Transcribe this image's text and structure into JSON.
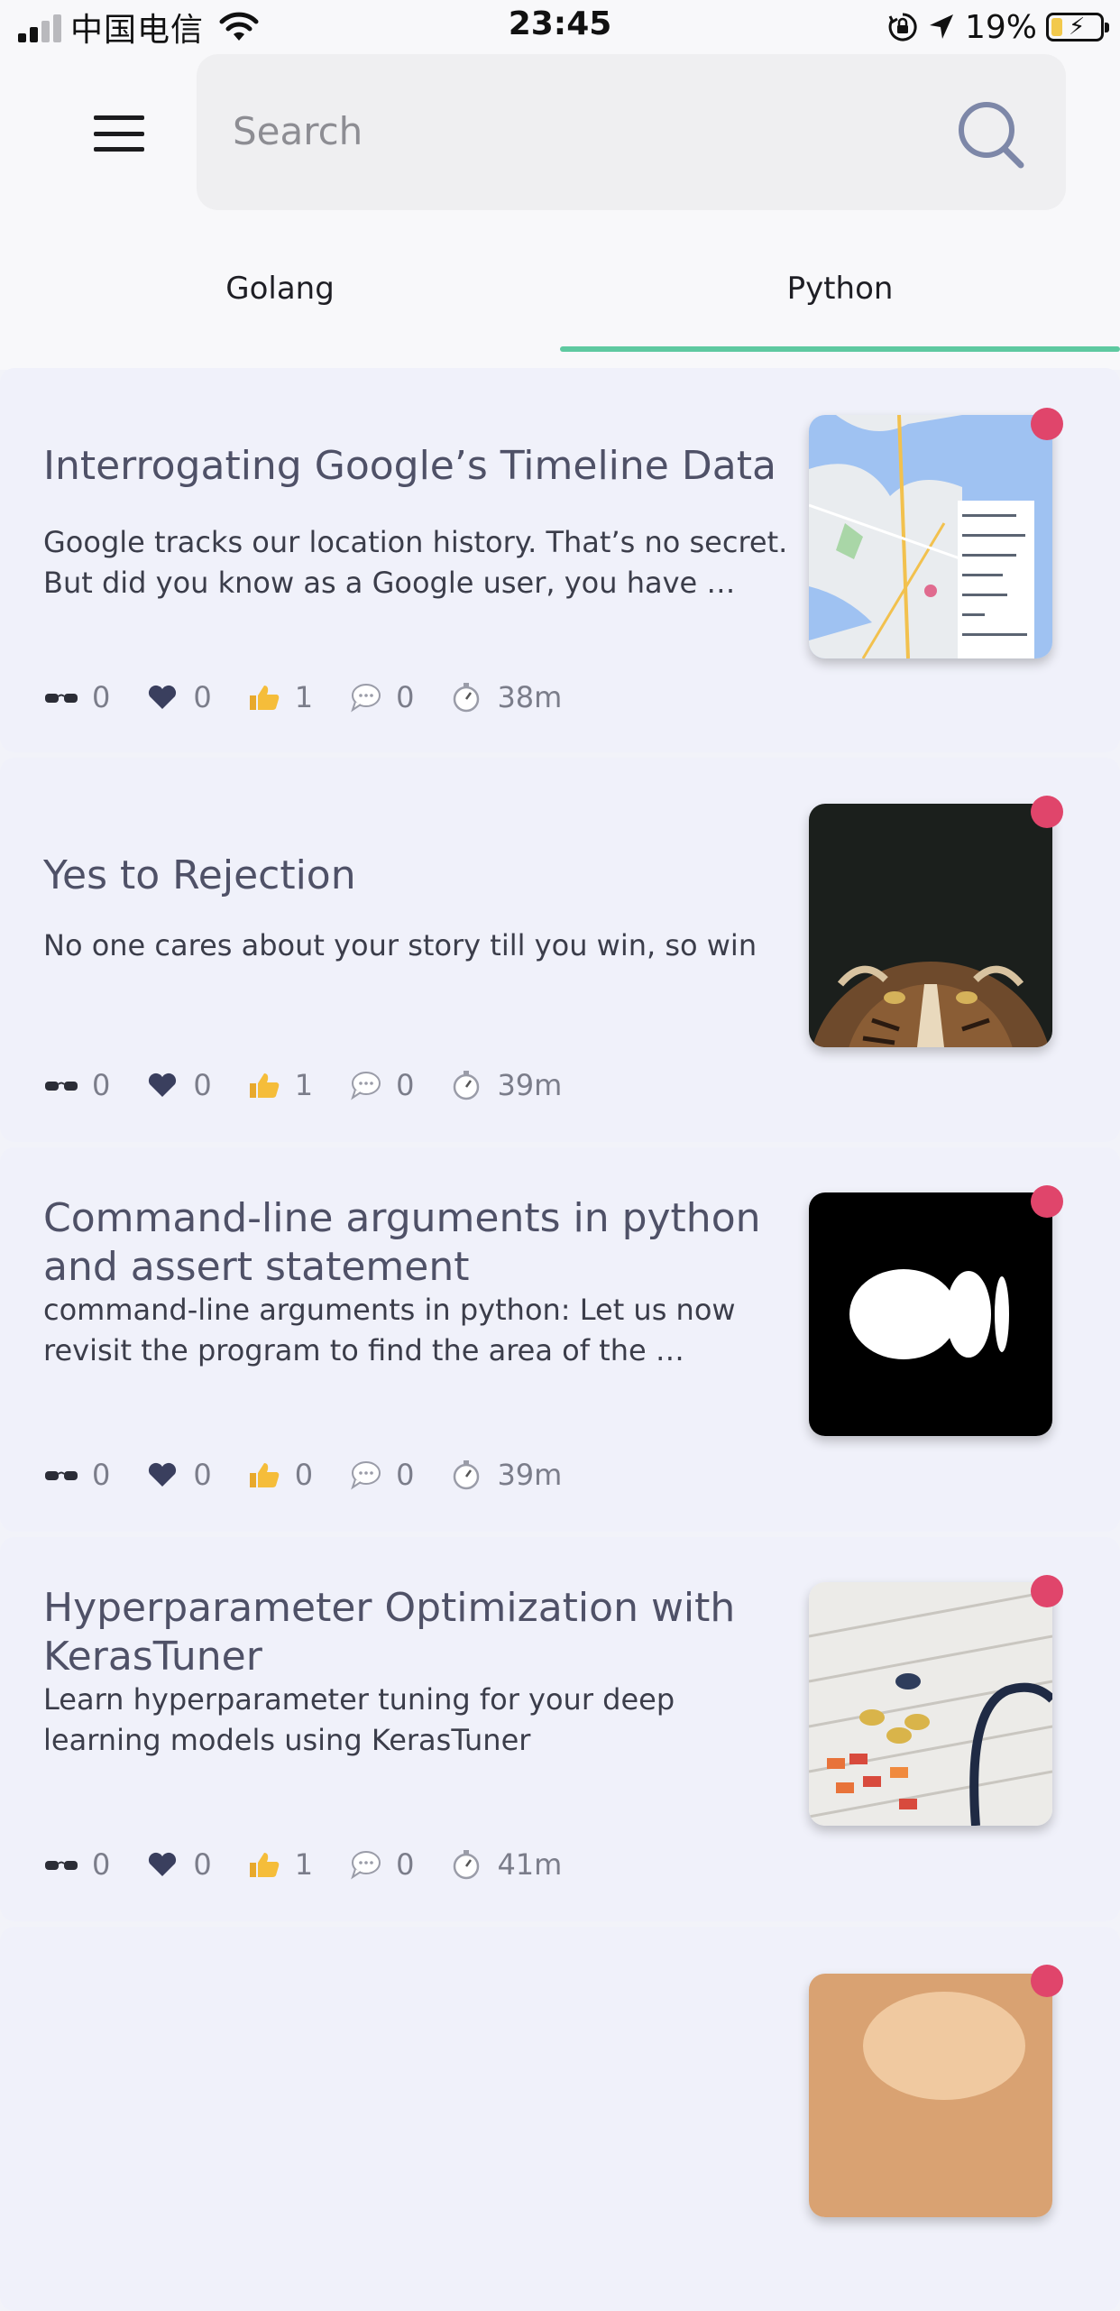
{
  "status_bar": {
    "carrier": "中国电信",
    "time": "23:45",
    "battery": "19%"
  },
  "search": {
    "placeholder": "Search"
  },
  "tabs": [
    {
      "label": "Golang",
      "selected": false
    },
    {
      "label": "Python",
      "selected": true
    }
  ],
  "colors": {
    "accent": "#5ec9a0",
    "badge": "#e0456b",
    "title": "#4f5167"
  },
  "articles": [
    {
      "title": "Interrogating Google’s Timeline Data",
      "description": "Google tracks our location history. That’s no secret. But did you know as a Google user, you have …",
      "reads": "0",
      "likes": "0",
      "claps": "1",
      "comments": "0",
      "read_time": "38m",
      "thumbnail": "map-thumbnail"
    },
    {
      "title": "Yes to Rejection",
      "description": "No one cares about your story till you win, so win",
      "reads": "0",
      "likes": "0",
      "claps": "1",
      "comments": "0",
      "read_time": "39m",
      "thumbnail": "tiger-thumbnail"
    },
    {
      "title": "Command-line arguments in python and assert statement",
      "description": "command-line arguments in python: Let us now revisit the program to find the area of the …",
      "reads": "0",
      "likes": "0",
      "claps": "0",
      "comments": "0",
      "read_time": "39m",
      "thumbnail": "medium-logo-thumbnail"
    },
    {
      "title": "Hyperparameter Optimization with KerasTuner",
      "description": "Learn hyperparameter tuning for your deep learning models using KerasTuner",
      "reads": "0",
      "likes": "0",
      "claps": "1",
      "comments": "0",
      "read_time": "41m",
      "thumbnail": "mixer-thumbnail"
    }
  ]
}
